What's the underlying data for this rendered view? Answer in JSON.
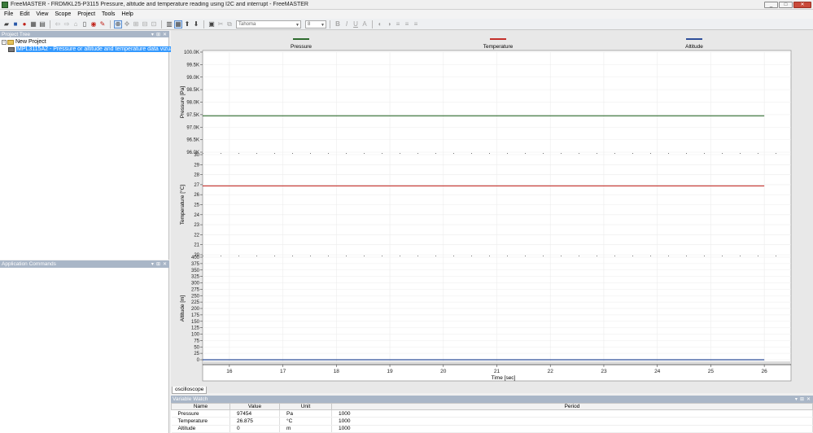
{
  "window": {
    "title": "FreeMASTER - FRDMKL25-P3115 Pressure, altitude and temperature reading using I2C and interrupt - FreeMASTER",
    "buttons": [
      "_",
      "□",
      "✕"
    ]
  },
  "menu": [
    "File",
    "Edit",
    "View",
    "Scope",
    "Project",
    "Tools",
    "Help"
  ],
  "toolbar": {
    "font": "Tahoma",
    "size": "8"
  },
  "project_tree": {
    "title": "Project Tree",
    "root": "New Project",
    "scope_item": "MPL3115A2 - Pressure or altitude and temperature data vizualization"
  },
  "app_commands": {
    "title": "Application Commands"
  },
  "scope": {
    "tab_label": "oscilloscope",
    "legend": [
      {
        "name": "Pressure",
        "color": "#2e6b2e"
      },
      {
        "name": "Temperature",
        "color": "#c4302b"
      },
      {
        "name": "Altitude",
        "color": "#2f4f9a"
      }
    ]
  },
  "chart_data": {
    "type": "line",
    "xlabel": "Time [sec]",
    "xlim": [
      15.5,
      26.5
    ],
    "x_ticks": [
      "16",
      "17",
      "18",
      "19",
      "20",
      "21",
      "22",
      "23",
      "24",
      "25",
      "26"
    ],
    "x": [
      15.5,
      26
    ],
    "series": [
      {
        "name": "Pressure",
        "color": "#2e6b2e",
        "values": [
          97454,
          97454
        ]
      },
      {
        "name": "Temperature",
        "color": "#c4302b",
        "values": [
          26.875,
          26.875
        ]
      },
      {
        "name": "Altitude",
        "color": "#2f4f9a",
        "values": [
          0,
          0
        ]
      }
    ],
    "panels": [
      {
        "series": "Pressure",
        "ylabel": "Pressure [Pa]",
        "ylim": [
          96000,
          100000
        ],
        "y_tick_values": [
          96000,
          96500,
          97000,
          97500,
          98000,
          98500,
          99000,
          99500,
          100000
        ],
        "y_ticks": [
          "96.0K",
          "96.5K",
          "97.0K",
          "97.5K",
          "98.0K",
          "98.5K",
          "99.0K",
          "99.5K",
          "100.0K"
        ]
      },
      {
        "series": "Temperature",
        "ylabel": "Temperature [°C]",
        "ylim": [
          20,
          30
        ],
        "y_tick_values": [
          20,
          21,
          22,
          23,
          24,
          25,
          26,
          27,
          28,
          29,
          30
        ],
        "y_ticks": [
          "20",
          "21",
          "22",
          "23",
          "24",
          "25",
          "26",
          "27",
          "28",
          "29",
          "30"
        ]
      },
      {
        "series": "Altitude",
        "ylabel": "Altitude [m]",
        "ylim": [
          0,
          400
        ],
        "y_tick_values": [
          0,
          25,
          50,
          75,
          100,
          125,
          150,
          175,
          200,
          225,
          250,
          275,
          300,
          325,
          350,
          375,
          400
        ],
        "y_ticks": [
          "0",
          "25",
          "50",
          "75",
          "100",
          "125",
          "150",
          "175",
          "200",
          "225",
          "250",
          "275",
          "300",
          "325",
          "350",
          "375",
          "400"
        ]
      }
    ]
  },
  "variable_watch": {
    "title": "Variable Watch",
    "columns": [
      "Name",
      "Value",
      "Unit",
      "Period"
    ],
    "rows": [
      {
        "name": "Pressure",
        "value": "97454",
        "unit": "Pa",
        "period": "1000"
      },
      {
        "name": "Temperature",
        "value": "26.875",
        "unit": "°C",
        "period": "1000"
      },
      {
        "name": "Altitude",
        "value": "0",
        "unit": "m",
        "period": "1000"
      }
    ]
  }
}
